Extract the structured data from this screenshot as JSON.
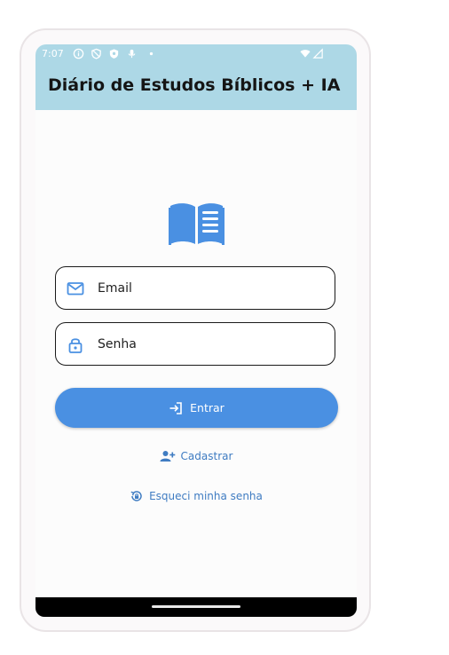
{
  "status_bar": {
    "time": "7:07"
  },
  "app_bar": {
    "title": "Diário de Estudos Bíblicos + IA"
  },
  "form": {
    "email": {
      "placeholder": "Email",
      "value": ""
    },
    "password": {
      "placeholder": "Senha",
      "value": ""
    }
  },
  "actions": {
    "login_label": "Entrar",
    "register_label": "Cadastrar",
    "forgot_label": "Esqueci minha senha"
  },
  "icons": {
    "logo": "open-book-icon",
    "email": "envelope-icon",
    "password": "lock-icon",
    "login": "login-icon",
    "register": "person-add-icon",
    "forgot": "lock-reset-icon"
  },
  "colors": {
    "app_bar": "#add8e6",
    "primary": "#4a90e2",
    "link": "#3f7cc2"
  }
}
